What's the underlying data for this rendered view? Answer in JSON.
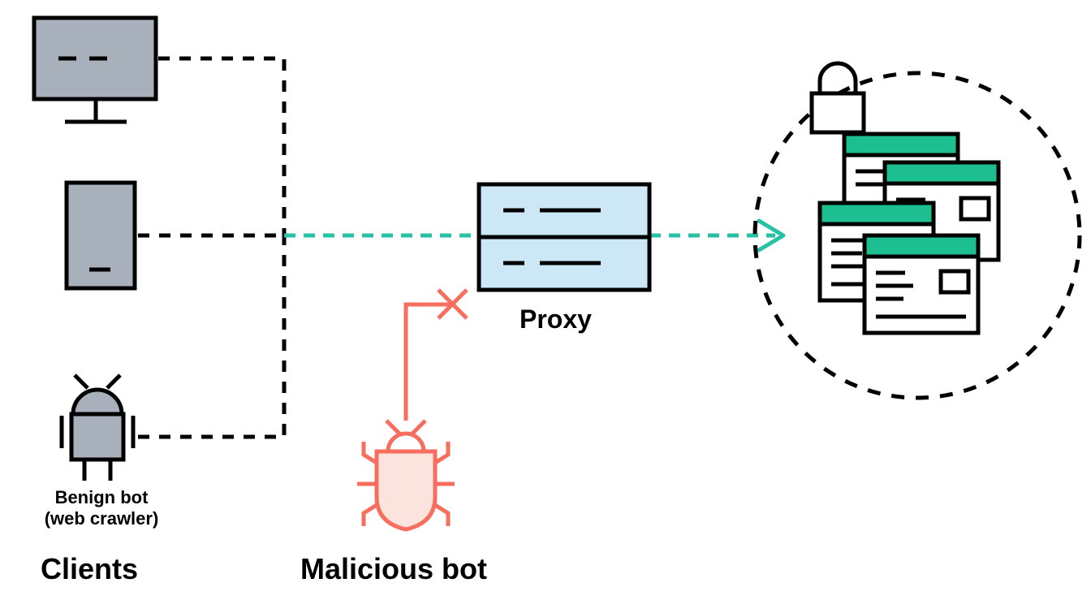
{
  "labels": {
    "clients": "Clients",
    "benign_bot_line1": "Benign bot",
    "benign_bot_line2": "(web crawler)",
    "malicious_bot": "Malicious bot",
    "proxy": "Proxy"
  },
  "colors": {
    "black": "#000000",
    "gray_fill": "#A8B0BC",
    "blue_fill": "#CCE8F7",
    "teal": "#27C2A6",
    "coral": "#F76E5E",
    "coral_fill": "#FBE3DE",
    "green_header": "#1DBF91"
  },
  "nodes": {
    "desktop": {
      "type": "client",
      "kind": "desktop"
    },
    "mobile": {
      "type": "client",
      "kind": "mobile"
    },
    "benign_bot": {
      "type": "client",
      "kind": "bot"
    },
    "malicious_bot": {
      "type": "threat",
      "kind": "bug"
    },
    "proxy": {
      "type": "proxy"
    },
    "protected_pages": {
      "type": "target",
      "protected": true
    }
  },
  "edges": [
    {
      "from": "desktop",
      "to": "proxy",
      "style": "dashed-black",
      "allowed": true
    },
    {
      "from": "mobile",
      "to": "proxy",
      "style": "dashed-black",
      "allowed": true
    },
    {
      "from": "benign_bot",
      "to": "proxy",
      "style": "dashed-black",
      "allowed": true
    },
    {
      "from": "malicious_bot",
      "to": "proxy",
      "style": "solid-coral",
      "allowed": false,
      "blocked_marker": "x"
    },
    {
      "from": "proxy",
      "to": "protected_pages",
      "style": "dashed-teal-arrow",
      "allowed": true
    }
  ]
}
